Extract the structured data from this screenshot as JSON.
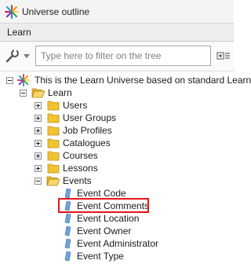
{
  "window": {
    "title": "Universe outline"
  },
  "subheader": {
    "label": "Learn"
  },
  "filter": {
    "placeholder": "Type here to filter on the tree",
    "value": ""
  },
  "tree": {
    "root": "This is the Learn Universe based on standard Learn",
    "universe": "Learn",
    "folders": [
      "Users",
      "User Groups",
      "Job Profiles",
      "Catalogues",
      "Courses",
      "Lessons"
    ],
    "open_folder": "Events",
    "objects": [
      "Event Code",
      "Event Comments",
      "Event Location",
      "Event Owner",
      "Event Administrator",
      "Event Type"
    ],
    "highlighted": "Event Comments"
  },
  "colors": {
    "highlight_border": "#e8141b",
    "folder": "#f2c331"
  }
}
